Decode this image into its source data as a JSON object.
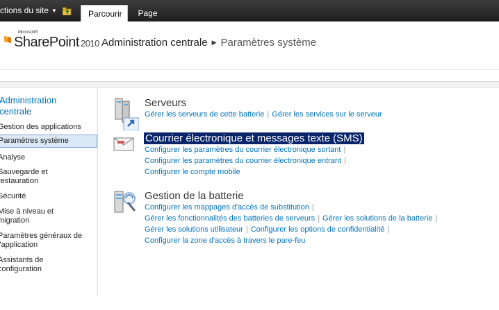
{
  "ribbon": {
    "site_actions": "ctions du site",
    "tabs": [
      {
        "label": "Parcourir"
      },
      {
        "label": "Page"
      }
    ]
  },
  "header": {
    "logo_small": "Microsoft®",
    "logo_main": "SharePoint",
    "logo_year": "2010",
    "breadcrumb_root": "Administration centrale",
    "breadcrumb_current": "Paramètres système"
  },
  "sidebar": {
    "header": "Administration centrale",
    "items": [
      {
        "label": "Gestion des applications"
      },
      {
        "label": "Paramètres système"
      },
      {
        "label": "Analyse"
      },
      {
        "label": "Sauvegarde et restauration"
      },
      {
        "label": "Sécurité"
      },
      {
        "label": "Mise à niveau et migration"
      },
      {
        "label": "Paramètres généraux de l'application"
      },
      {
        "label": "Assistants de configuration"
      }
    ]
  },
  "groups": [
    {
      "title": "Serveurs",
      "rows": [
        [
          "Gérer les serveurs de cette batterie",
          "Gérer les services sur le serveur"
        ]
      ]
    },
    {
      "title": "Courrier électronique et messages texte (SMS)",
      "rows": [
        [
          "Configurer les paramètres du courrier électronique sortant"
        ],
        [
          "Configurer les paramètres du courrier électronique entrant"
        ],
        [
          "Configurer le compte mobile"
        ]
      ]
    },
    {
      "title": "Gestion de la batterie",
      "rows": [
        [
          "Configurer les mappages d'accès de substitution"
        ],
        [
          "Gérer les fonctionnalités des batteries de serveurs",
          "Gérer les solutions de la batterie"
        ],
        [
          "Gérer les solutions utilisateur",
          "Configurer les options de confidentialité"
        ],
        [
          "Configurer la zone d'accès à travers le pare-feu"
        ]
      ]
    }
  ],
  "colors": {
    "link": "#0072bc",
    "selection_highlight": "#0a246a",
    "ribbon": "#2b2b2b"
  }
}
